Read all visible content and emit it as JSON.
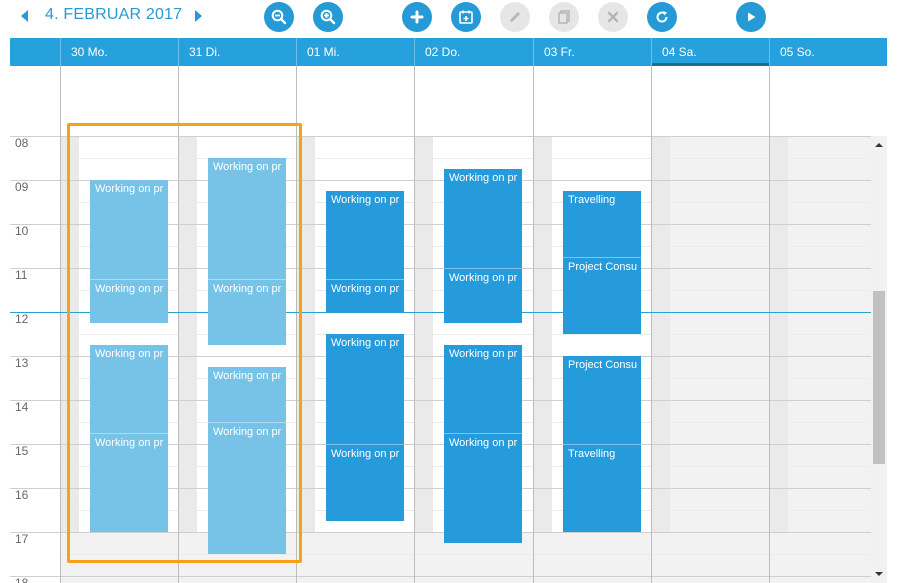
{
  "toolbar": {
    "date_label": "4. FEBRUAR 2017",
    "prev_icon": "chevron-left-icon",
    "next_icon": "chevron-right-icon",
    "buttons": [
      {
        "name": "zoom-out",
        "icon": "zoom-out-icon",
        "state": "active"
      },
      {
        "name": "zoom-in",
        "icon": "zoom-in-icon",
        "state": "active"
      },
      {
        "name": "add",
        "icon": "plus-icon",
        "state": "active"
      },
      {
        "name": "add-event",
        "icon": "calendar-add-icon",
        "state": "active"
      },
      {
        "name": "edit",
        "icon": "pencil-icon",
        "state": "disabled"
      },
      {
        "name": "copy",
        "icon": "copy-icon",
        "state": "disabled"
      },
      {
        "name": "delete",
        "icon": "close-icon",
        "state": "disabled"
      },
      {
        "name": "refresh",
        "icon": "refresh-icon",
        "state": "active"
      },
      {
        "name": "play",
        "icon": "play-icon",
        "state": "active"
      }
    ]
  },
  "days": [
    {
      "label": "30 Mo."
    },
    {
      "label": "31 Di."
    },
    {
      "label": "01 Mi."
    },
    {
      "label": "02 Do."
    },
    {
      "label": "03 Fr."
    },
    {
      "label": "04 Sa.",
      "selected": true
    },
    {
      "label": "05 So."
    }
  ],
  "hours": [
    "08",
    "09",
    "10",
    "11",
    "12",
    "13",
    "14",
    "15",
    "16",
    "17",
    "18"
  ],
  "events": [
    {
      "day": 0,
      "start": 9.0,
      "end": 12.25,
      "style": "light",
      "segments": [
        {
          "label": "Working on pr",
          "at": 9.0
        },
        {
          "label": "Working on pr",
          "at": 11.25
        }
      ]
    },
    {
      "day": 0,
      "start": 12.75,
      "end": 17.0,
      "style": "light",
      "segments": [
        {
          "label": "Working on pr",
          "at": 12.75
        },
        {
          "label": "Working on pr",
          "at": 14.75
        }
      ]
    },
    {
      "day": 1,
      "start": 8.5,
      "end": 12.75,
      "style": "light",
      "segments": [
        {
          "label": "Working on pr",
          "at": 8.5
        },
        {
          "label": "Working on pr",
          "at": 11.25
        }
      ]
    },
    {
      "day": 1,
      "start": 13.25,
      "end": 17.5,
      "style": "light",
      "segments": [
        {
          "label": "Working on pr",
          "at": 13.25
        },
        {
          "label": "Working on pr",
          "at": 14.5
        }
      ]
    },
    {
      "day": 2,
      "start": 9.25,
      "end": 12.0,
      "style": "dark",
      "segments": [
        {
          "label": "Working on pr",
          "at": 9.25
        },
        {
          "label": "Working on pr",
          "at": 11.25
        }
      ]
    },
    {
      "day": 2,
      "start": 12.5,
      "end": 16.75,
      "style": "dark",
      "segments": [
        {
          "label": "Working on pr",
          "at": 12.5
        },
        {
          "label": "Working on pr",
          "at": 15.0
        }
      ]
    },
    {
      "day": 3,
      "start": 8.75,
      "end": 12.25,
      "style": "dark",
      "segments": [
        {
          "label": "Working on pr",
          "at": 8.75
        },
        {
          "label": "Working on pr",
          "at": 11.0
        }
      ]
    },
    {
      "day": 3,
      "start": 12.75,
      "end": 17.25,
      "style": "dark",
      "segments": [
        {
          "label": "Working on pr",
          "at": 12.75
        },
        {
          "label": "Working on pr",
          "at": 14.75
        }
      ]
    },
    {
      "day": 4,
      "start": 9.25,
      "end": 12.5,
      "style": "dark",
      "segments": [
        {
          "label": "Travelling",
          "at": 9.25
        },
        {
          "label": "Project Consu",
          "at": 10.75
        }
      ]
    },
    {
      "day": 4,
      "start": 13.0,
      "end": 17.0,
      "style": "dark",
      "segments": [
        {
          "label": "Project Consu",
          "at": 13.0
        },
        {
          "label": "Travelling",
          "at": 15.0
        }
      ]
    }
  ],
  "current_time": 12.0,
  "colors": {
    "accent": "#259ad6",
    "event_dark": "#259bdb",
    "event_light": "#77c3e8",
    "selection": "#f7a01a"
  }
}
